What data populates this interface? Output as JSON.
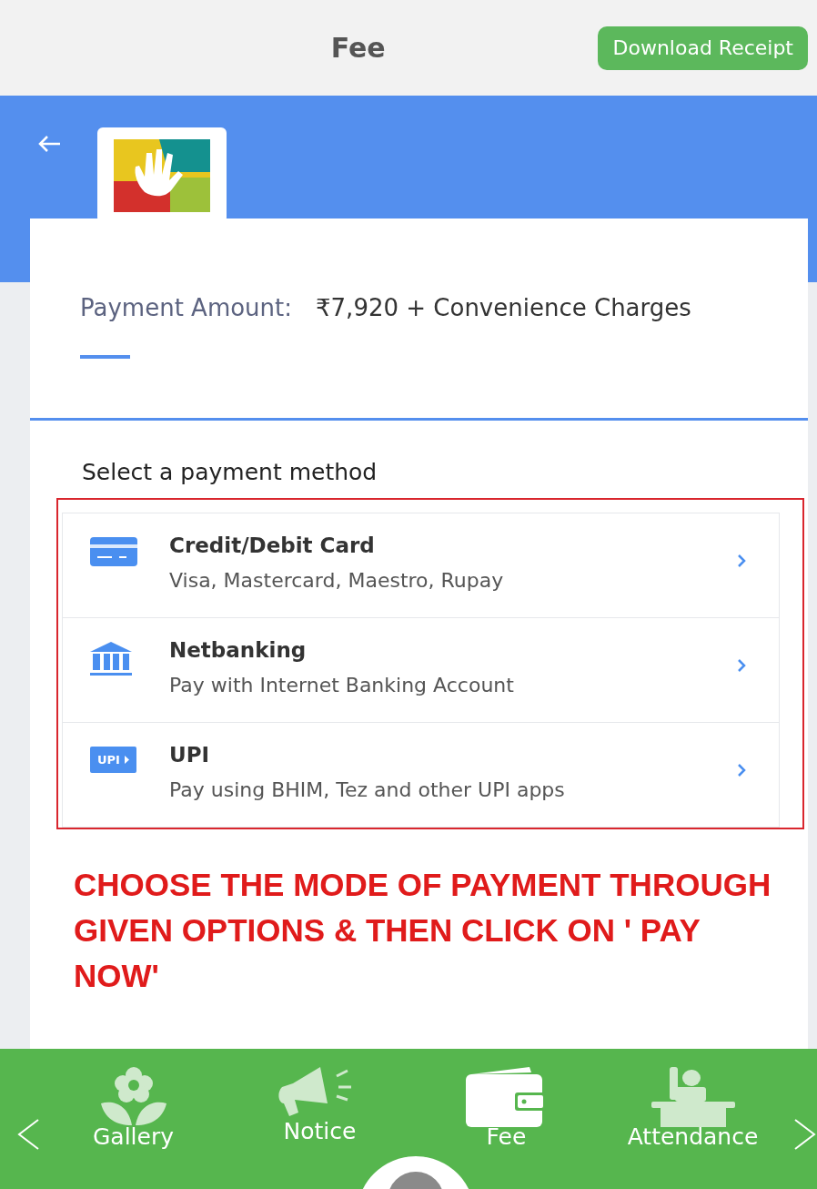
{
  "header": {
    "title": "Fee",
    "download_button": "Download Receipt"
  },
  "payment": {
    "label": "Payment Amount:",
    "amount": "₹7,920 + Convenience Charges"
  },
  "methods_heading": "Select a payment method",
  "methods": [
    {
      "kind": "card",
      "title": "Credit/Debit Card",
      "subtitle": "Visa, Mastercard, Maestro, Rupay"
    },
    {
      "kind": "bank",
      "title": "Netbanking",
      "subtitle": "Pay with Internet Banking Account"
    },
    {
      "kind": "upi",
      "badge": "UPI",
      "title": "UPI",
      "subtitle": "Pay using BHIM, Tez and other UPI apps"
    }
  ],
  "annotation": "CHOOSE THE MODE OF PAYMENT THROUGH GIVEN OPTIONS & THEN CLICK ON ' PAY NOW'",
  "nav": [
    {
      "kind": "gallery",
      "label": "Gallery",
      "selected": false
    },
    {
      "kind": "notice",
      "label": "Notice",
      "selected": false
    },
    {
      "kind": "fee",
      "label": "Fee",
      "selected": true
    },
    {
      "kind": "attendance",
      "label": "Attendance",
      "selected": false
    }
  ]
}
